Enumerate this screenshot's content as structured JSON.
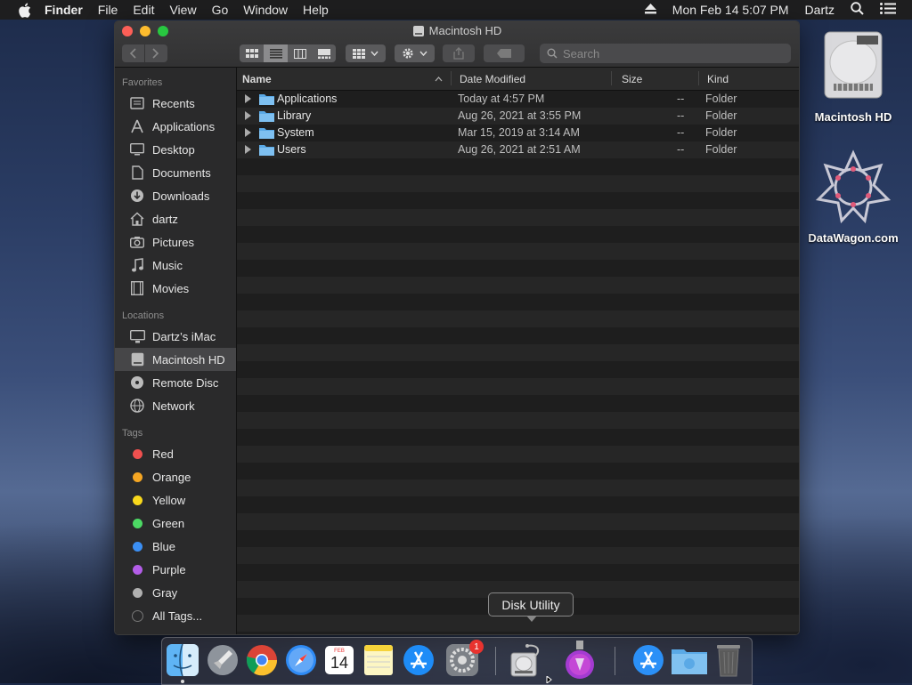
{
  "menubar": {
    "app": "Finder",
    "items": [
      "File",
      "Edit",
      "View",
      "Go",
      "Window",
      "Help"
    ],
    "clock": "Mon Feb 14  5:07 PM",
    "user": "Dartz"
  },
  "window": {
    "title": "Macintosh HD",
    "search_placeholder": "Search"
  },
  "sidebar": {
    "favorites_label": "Favorites",
    "favorites": [
      "Recents",
      "Applications",
      "Desktop",
      "Documents",
      "Downloads",
      "dartz",
      "Pictures",
      "Music",
      "Movies"
    ],
    "locations_label": "Locations",
    "locations": [
      "Dartz’s iMac",
      "Macintosh HD",
      "Remote Disc",
      "Network"
    ],
    "tags_label": "Tags",
    "tags": [
      "Red",
      "Orange",
      "Yellow",
      "Green",
      "Blue",
      "Purple",
      "Gray",
      "All Tags..."
    ],
    "tag_colors": [
      "#f0504f",
      "#f5a623",
      "#f8d81c",
      "#4cd964",
      "#3b8ff4",
      "#b35de8",
      "#b0b0b0",
      "#444444"
    ]
  },
  "columns": {
    "name": "Name",
    "date": "Date Modified",
    "size": "Size",
    "kind": "Kind"
  },
  "files": [
    {
      "name": "Applications",
      "date": "Today at 4:57 PM",
      "size": "--",
      "kind": "Folder"
    },
    {
      "name": "Library",
      "date": "Aug 26, 2021 at 3:55 PM",
      "size": "--",
      "kind": "Folder"
    },
    {
      "name": "System",
      "date": "Mar 15, 2019 at 3:14 AM",
      "size": "--",
      "kind": "Folder"
    },
    {
      "name": "Users",
      "date": "Aug 26, 2021 at 2:51 AM",
      "size": "--",
      "kind": "Folder"
    }
  ],
  "desktop": {
    "hd_label": "Macintosh HD",
    "logo_label": "DataWagon.com"
  },
  "dock": {
    "tooltip": "Disk Utility",
    "badge": "1",
    "calendar_month": "FEB",
    "calendar_day": "14"
  }
}
